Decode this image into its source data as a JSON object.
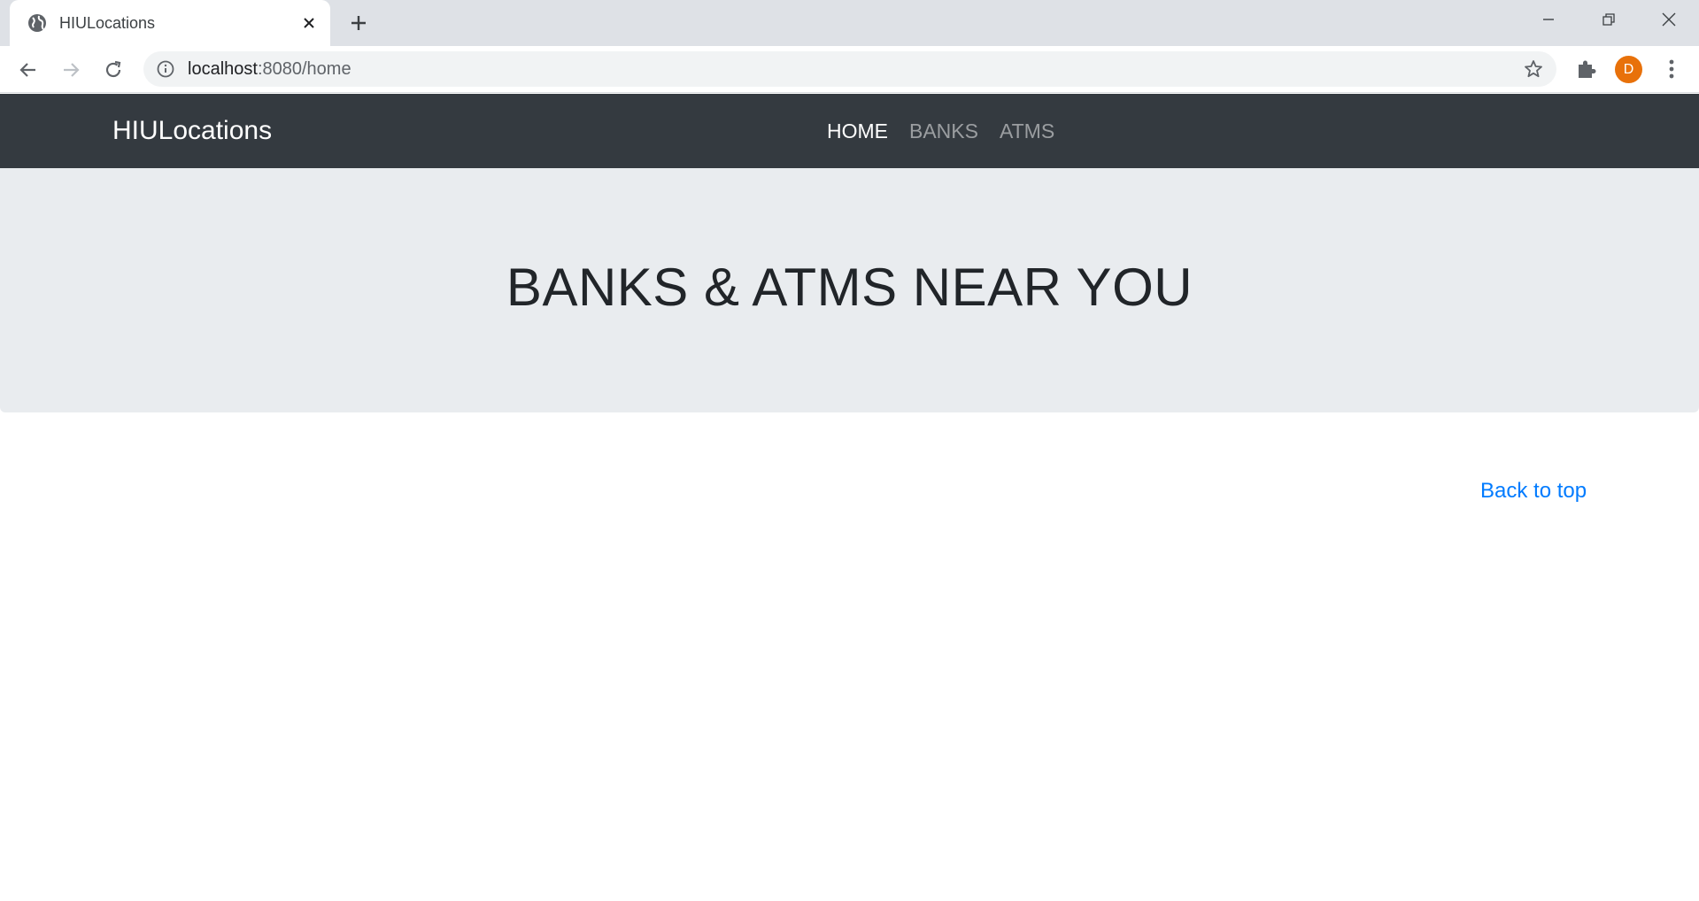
{
  "browser": {
    "tab_title": "HIULocations",
    "url_host": "localhost",
    "url_path": ":8080/home",
    "avatar_initial": "D"
  },
  "navbar": {
    "brand": "HIULocations",
    "links": [
      {
        "label": "HOME",
        "active": true
      },
      {
        "label": "BANKS",
        "active": false
      },
      {
        "label": "ATMS",
        "active": false
      }
    ]
  },
  "jumbotron": {
    "heading": "BANKS & ATMS NEAR YOU"
  },
  "footer": {
    "back_to_top": "Back to top"
  },
  "colors": {
    "navbar_bg": "#343a40",
    "jumbotron_bg": "#e9ecef",
    "link": "#007bff",
    "avatar": "#e8710a"
  }
}
